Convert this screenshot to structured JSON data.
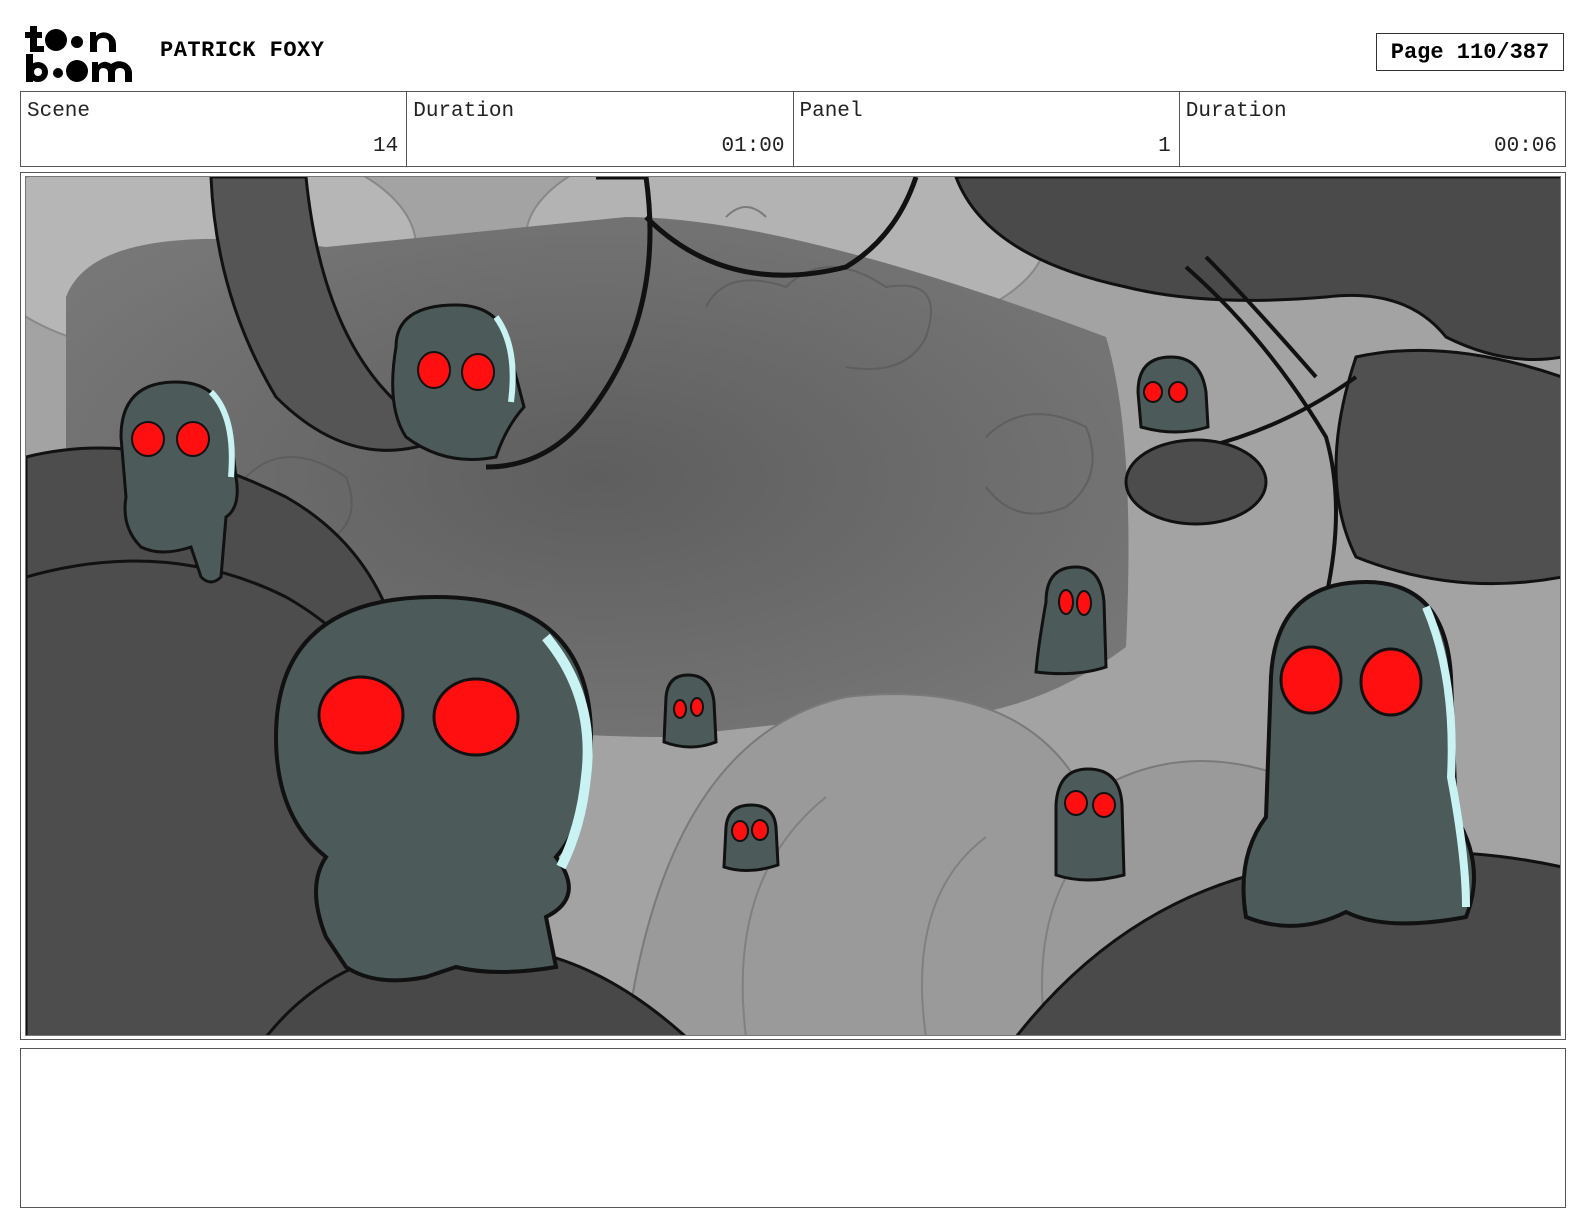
{
  "header": {
    "logo_text": "toonboom",
    "project_title": "PATRICK FOXY",
    "page": "Page 110/387"
  },
  "info": {
    "scene_label": "Scene",
    "scene_value": "14",
    "scene_duration_label": "Duration",
    "scene_duration_value": "01:00",
    "panel_label": "Panel",
    "panel_value": "1",
    "panel_duration_label": "Duration",
    "panel_duration_value": "00:06"
  },
  "colors": {
    "ghost_body": "#4c5a5a",
    "ghost_eye": "#ff0f0f",
    "ghost_rim": "#c9f2f2",
    "bg_light": "#a8a8a8",
    "bg_dark": "#4f4f4f",
    "cave_mid": "#6e6e6e"
  },
  "notes": {
    "text": ""
  }
}
